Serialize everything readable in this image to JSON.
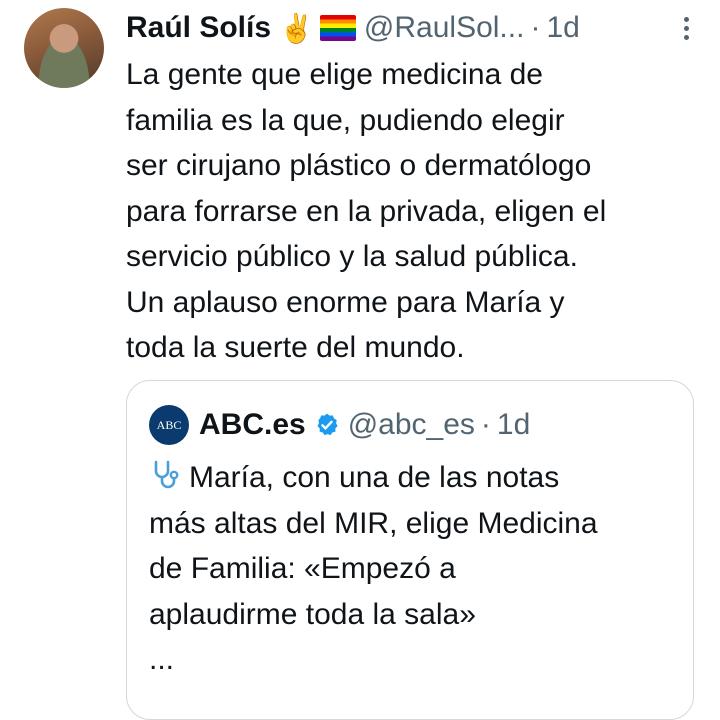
{
  "tweet": {
    "author_name": "Raúl Solís",
    "author_emoji": "✌️",
    "author_flag": "rainbow-flag",
    "handle": "@RaulSol...",
    "separator": "·",
    "time": "1d",
    "text": "La gente que elige medicina de\nfamilia es la que, pudiendo elegir\nser cirujano plástico o dermatólogo\npara forrarse en la privada, eligen el\nservicio público y la salud pública.\nUn aplauso enorme para María y\ntoda la suerte del mundo."
  },
  "quote": {
    "logo_text": "ABC",
    "author_name": "ABC.es",
    "handle": "@abc_es",
    "separator": "·",
    "time": "1d",
    "text": "María, con una de las notas\nmás altas del MIR, elige Medicina\nde Familia: «Empezó a\naplaudirme toda la sala»\n...",
    "lead_icon": "stethoscope-icon"
  },
  "colors": {
    "text": "#0f1419",
    "secondary": "#536471",
    "border": "#cfd9de",
    "verified": "#1d9bf0",
    "abc_logo": "#0a3a6e"
  }
}
